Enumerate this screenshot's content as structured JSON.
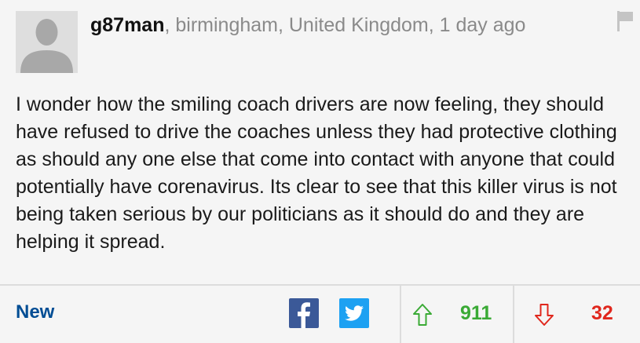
{
  "comment": {
    "username": "g87man",
    "location": ", birmingham, United Kingdom, 1 day ago",
    "text": "I wonder how the smiling coach drivers are now feeling, they should have refused to drive the coaches unless they had protective clothing as should any one else that come into contact with anyone that could potentially have corenavirus. Its clear to see that this killer virus is not being taken serious by our politicians as it should do and they are helping it spread."
  },
  "footer": {
    "new_label": "New",
    "upvotes": "911",
    "downvotes": "32"
  },
  "icons": {
    "flag": "flag-icon",
    "facebook": "facebook-icon",
    "twitter": "twitter-icon",
    "upvote": "arrow-up-icon",
    "downvote": "arrow-down-icon"
  },
  "colors": {
    "new_link": "#004d94",
    "facebook": "#3b5998",
    "twitter": "#1da1f2",
    "upvote": "#3aaa35",
    "downvote": "#e0271d",
    "background": "#f5f5f5"
  }
}
